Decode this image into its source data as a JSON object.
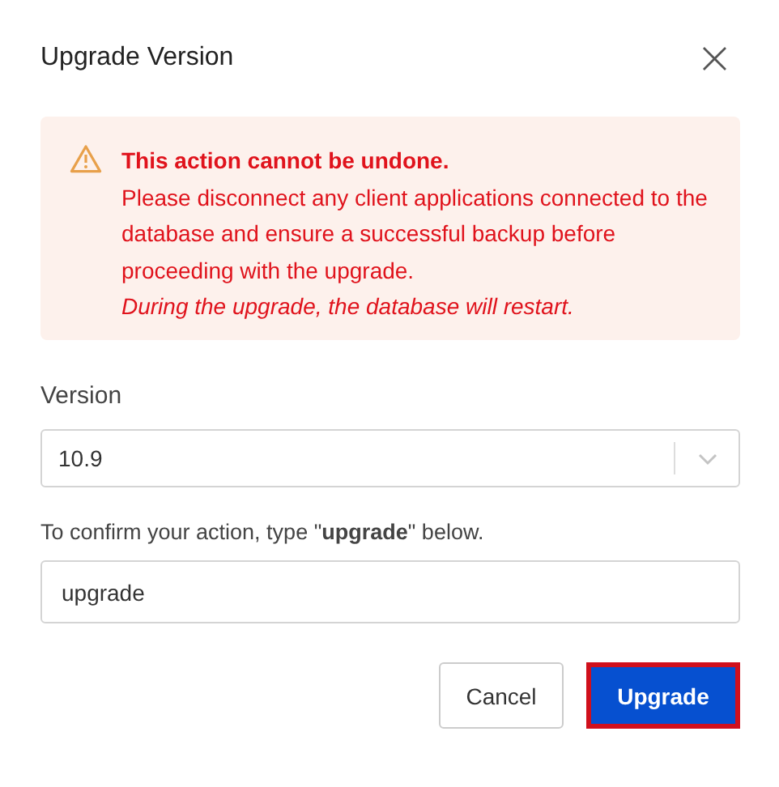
{
  "dialog": {
    "title": "Upgrade Version",
    "close": "×"
  },
  "alert": {
    "title": "This action cannot be undone.",
    "message": "Please disconnect any client applications connected to the database and ensure a successful backup before proceeding with the upgrade.",
    "note": "During the upgrade, the database will restart."
  },
  "version": {
    "label": "Version",
    "value": "10.9"
  },
  "confirm": {
    "instruction": "To confirm your action, type \"**upgrade**\" below.",
    "value": "upgrade"
  },
  "buttons": [
    {
      "label": "Cancel",
      "kind": "secondary",
      "highlighted": false
    },
    {
      "label": "Upgrade",
      "kind": "primary",
      "highlighted": true
    }
  ]
}
